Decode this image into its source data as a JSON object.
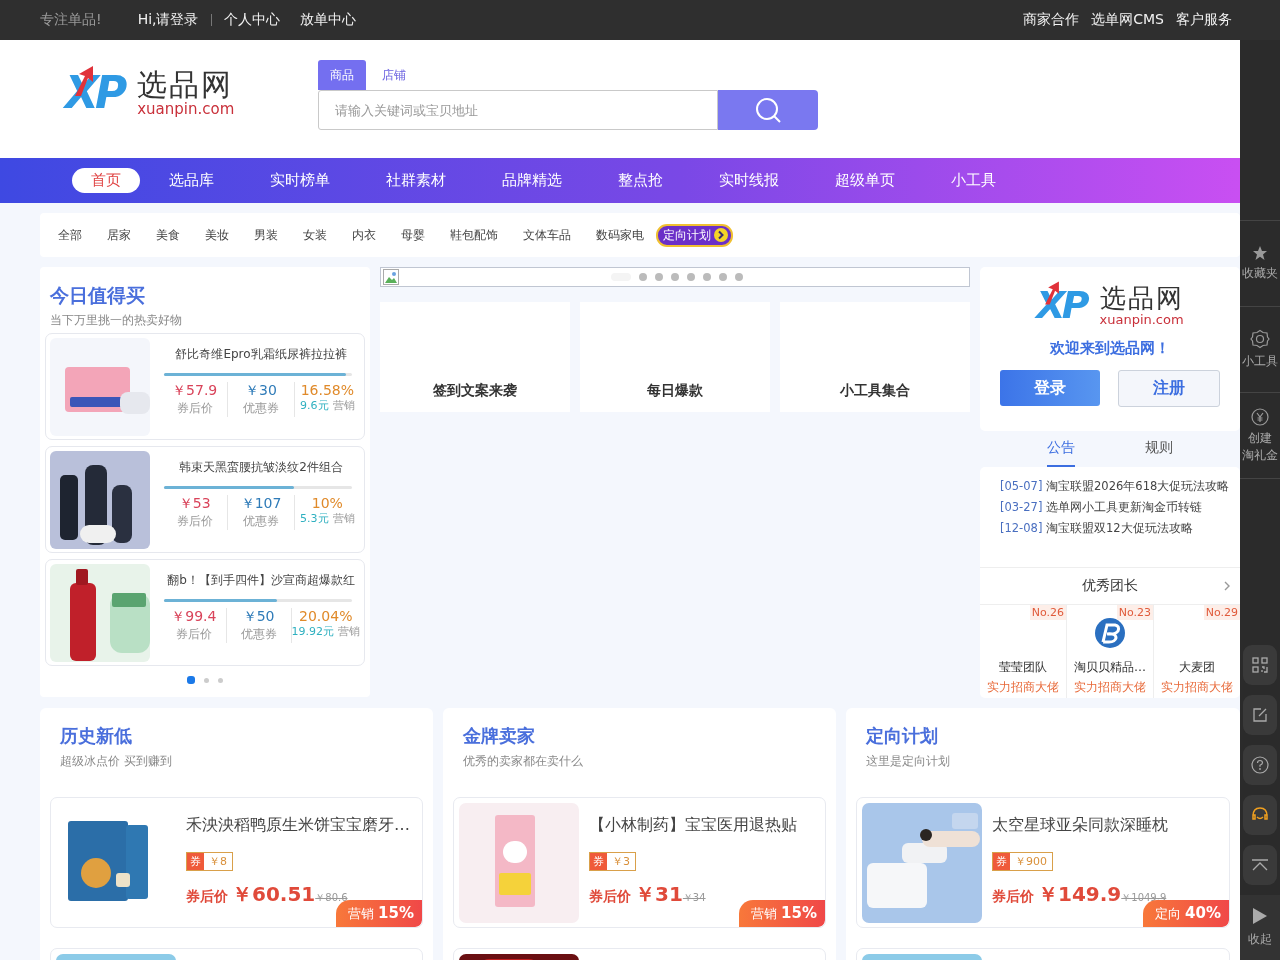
{
  "top_bar": {
    "slogan": "专注单品!",
    "links": [
      "Hi,请登录",
      "个人中心",
      "放单中心"
    ],
    "right_links": [
      "商家合作",
      "选单网CMS",
      "客户服务"
    ]
  },
  "header": {
    "logo": {
      "mark": "XP",
      "name": "选品网",
      "domain": "xuanpin.com"
    },
    "search_tabs": [
      {
        "label": "商品",
        "selected": true
      },
      {
        "label": "店铺",
        "selected": false
      }
    ],
    "search": {
      "placeholder": "请输入关键词或宝贝地址"
    }
  },
  "nav": [
    {
      "label": "首页",
      "selected": true
    },
    {
      "label": "选品库",
      "selected": false
    },
    {
      "label": "实时榜单",
      "selected": false
    },
    {
      "label": "社群素材",
      "selected": false
    },
    {
      "label": "品牌精选",
      "selected": false
    },
    {
      "label": "整点抢",
      "selected": false
    },
    {
      "label": "实时线报",
      "selected": false
    },
    {
      "label": "超级单页",
      "selected": false
    },
    {
      "label": "小工具",
      "selected": false
    }
  ],
  "categories": [
    "全部",
    "居家",
    "美食",
    "美妆",
    "男装",
    "女装",
    "内衣",
    "母婴",
    "鞋包配饰",
    "文体车品",
    "数码家电"
  ],
  "category_badge": "定向计划",
  "today": {
    "title": "今日值得买",
    "subtitle": "当下万里挑一的热卖好物",
    "items": [
      {
        "title": "舒比奇维Epro乳霜纸尿裤拉拉裤",
        "level": 0.97,
        "price": "￥57.9",
        "price_label": "券后价",
        "coupon": "￥30",
        "coupon_label": "优惠券",
        "rate": "16.58%",
        "commission": "9.6元",
        "commission_label": "营销"
      },
      {
        "title": "韩束天黑蛮腰抗皱淡纹2件组合",
        "level": 0.69,
        "price": "￥53",
        "price_label": "券后价",
        "coupon": "￥107",
        "coupon_label": "优惠券",
        "rate": "10%",
        "commission": "5.3元",
        "commission_label": "营销"
      },
      {
        "title": "翻b！【到手四件】沙宣商超爆款红",
        "level": 0.6,
        "price": "￥99.4",
        "price_label": "券后价",
        "coupon": "￥50",
        "coupon_label": "优惠券",
        "rate": "20.04%",
        "commission": "19.92元",
        "commission_label": "营销"
      }
    ],
    "pages": [
      {
        "selected": true
      },
      {
        "selected": false
      },
      {
        "selected": false
      }
    ]
  },
  "banner": {
    "dots": [
      {
        "selected": true
      },
      {
        "selected": false
      },
      {
        "selected": false
      },
      {
        "selected": false
      },
      {
        "selected": false
      },
      {
        "selected": false
      },
      {
        "selected": false
      },
      {
        "selected": false
      }
    ]
  },
  "tiles": [
    "签到文案来袭",
    "每日爆款",
    "小工具集合"
  ],
  "welcome": {
    "logo": {
      "mark": "XP",
      "name": "选品网",
      "domain": "xuanpin.com"
    },
    "message": "欢迎来到选品网！",
    "login": "登录",
    "register": "注册"
  },
  "notice_tabs": [
    {
      "label": "公告",
      "selected": true
    },
    {
      "label": "规则",
      "selected": false
    }
  ],
  "notices": [
    {
      "date": "[05-07]",
      "text": "淘宝联盟2026年618大促玩法攻略"
    },
    {
      "date": "[03-27]",
      "text": "选单网小工具更新淘金币转链"
    },
    {
      "date": "[12-08]",
      "text": "淘宝联盟双12大促玩法攻略"
    }
  ],
  "leaders": {
    "title": "优秀团长",
    "items": [
      {
        "rank": "No.26",
        "name": "莹莹团队",
        "tag": "实力招商大佬",
        "avatar": false
      },
      {
        "rank": "No.23",
        "name": "淘贝贝精品…",
        "tag": "实力招商大佬",
        "avatar": true
      },
      {
        "rank": "No.29",
        "name": "大麦团",
        "tag": "实力招商大佬",
        "avatar": false
      }
    ]
  },
  "sections": [
    {
      "title": "历史新低",
      "subtitle": "超级冰点价 买到赚到",
      "item": {
        "title": "禾泱泱稻鸭原生米饼宝宝磨牙…",
        "coupon_mark": "券",
        "coupon": "￥8",
        "price_label": "券后价",
        "price": "￥60.51",
        "original": "￥80.6",
        "tag_label": "营销",
        "tag_value": "15%"
      }
    },
    {
      "title": "金牌卖家",
      "subtitle": "优秀的卖家都在卖什么",
      "item": {
        "title": "【小林制药】宝宝医用退热贴",
        "coupon_mark": "券",
        "coupon": "￥3",
        "price_label": "券后价",
        "price": "￥31",
        "original": "￥34",
        "tag_label": "营销",
        "tag_value": "15%"
      }
    },
    {
      "title": "定向计划",
      "subtitle": "这里是定向计划",
      "item": {
        "title": "太空星球亚朵同款深睡枕",
        "coupon_mark": "券",
        "coupon": "￥900",
        "price_label": "券后价",
        "price": "￥149.9",
        "original": "￥1049.9",
        "tag_label": "定向",
        "tag_value": "40%"
      }
    }
  ],
  "sidebar": {
    "items": [
      {
        "kind": "star",
        "lines": [
          "收藏夹"
        ]
      },
      {
        "kind": "gear",
        "lines": [
          "小工具"
        ]
      },
      {
        "kind": "yen",
        "lines": [
          "创建",
          "淘礼金"
        ]
      }
    ],
    "buttons": [
      {
        "kind": "qr"
      },
      {
        "kind": "edit"
      },
      {
        "kind": "help"
      },
      {
        "kind": "service"
      },
      {
        "kind": "top"
      }
    ],
    "collapse": "收起"
  }
}
